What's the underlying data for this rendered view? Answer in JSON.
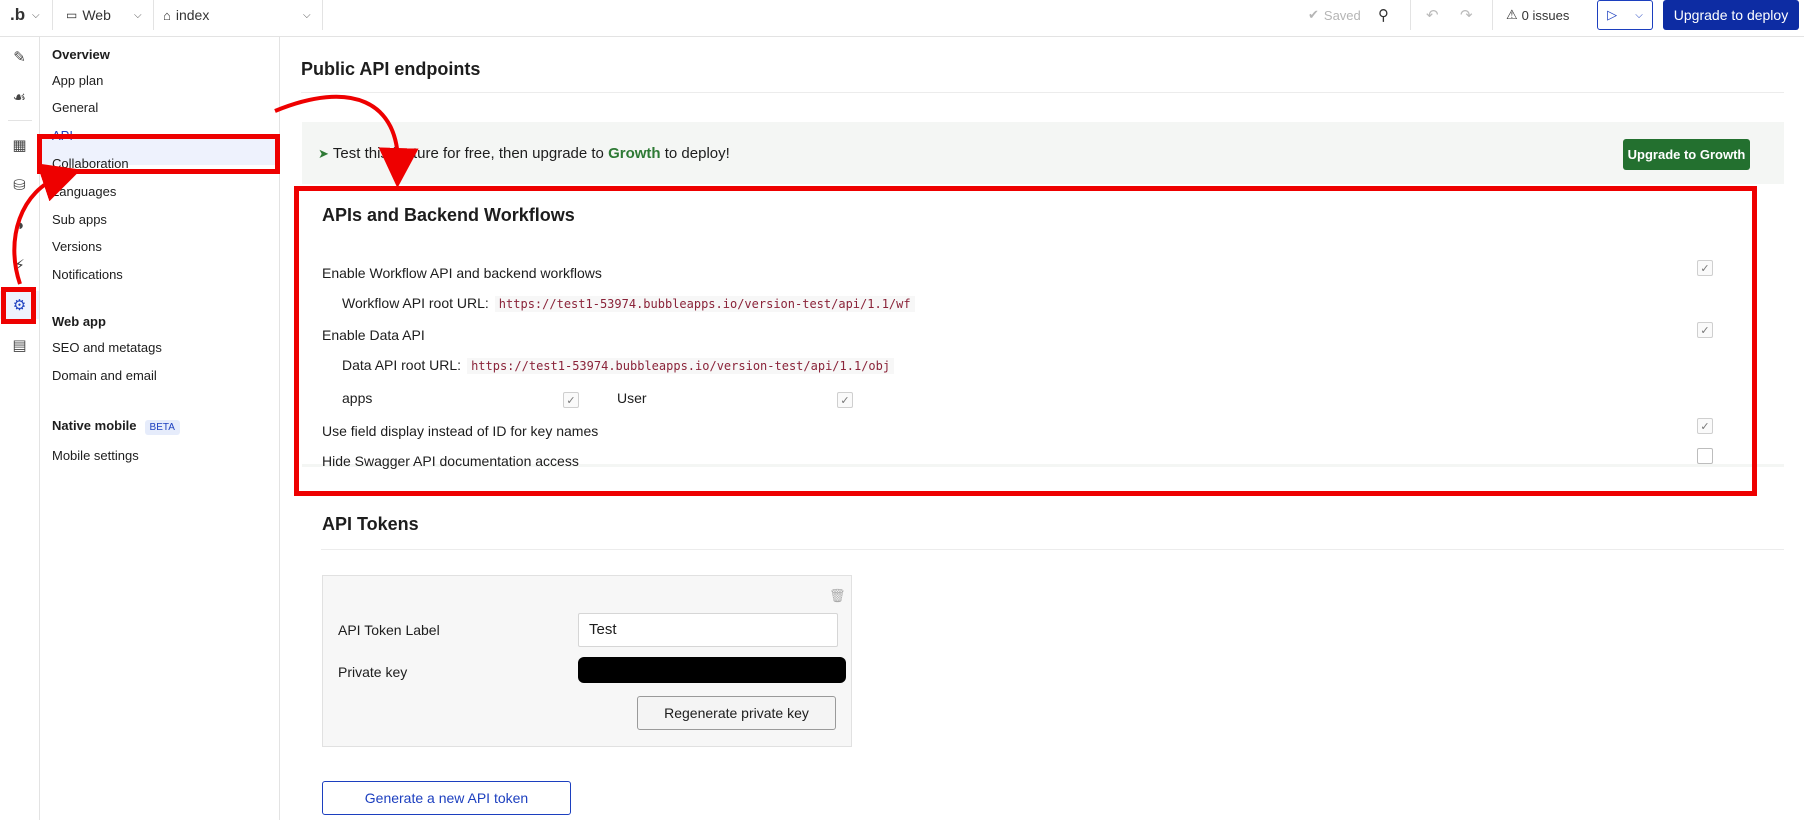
{
  "topbar": {
    "logo": ".b",
    "platform": "Web",
    "page": "index",
    "saved": "Saved",
    "issues": "0 issues",
    "deploy_label": "Upgrade to deploy"
  },
  "rail": {
    "icons": [
      "pencil-icon",
      "sitemap-icon",
      "layout-icon",
      "database-icon",
      "palette-icon",
      "plugin-icon",
      "gear-icon",
      "chart-icon"
    ]
  },
  "nav": {
    "overview": "Overview",
    "items": [
      "App plan",
      "General",
      "API",
      "Collaboration",
      "Languages",
      "Sub apps",
      "Versions",
      "Notifications"
    ],
    "web_app": "Web app",
    "web_items": [
      "SEO and metatags",
      "Domain and email"
    ],
    "native_mobile": "Native mobile",
    "beta": "BETA",
    "mobile_items": [
      "Mobile settings"
    ]
  },
  "main": {
    "title": "Public API endpoints",
    "upgrade_text_before": "Test this feature for free, then upgrade to",
    "upgrade_growth": "Growth",
    "upgrade_text_after": "to deploy!",
    "upgrade_button": "Upgrade to Growth"
  },
  "api": {
    "title": "APIs and Backend Workflows",
    "enable_workflow": "Enable Workflow API and backend workflows",
    "workflow_root_label": "Workflow API root URL:",
    "workflow_root_url": "https://test1-53974.bubbleapps.io/version-test/api/1.1/wf",
    "enable_data": "Enable Data API",
    "data_root_label": "Data API root URL:",
    "data_root_url": "https://test1-53974.bubbleapps.io/version-test/api/1.1/obj",
    "types": [
      "apps",
      "User"
    ],
    "field_display": "Use field display instead of ID for key names",
    "hide_swagger": "Hide Swagger API documentation access"
  },
  "tokens": {
    "title": "API Tokens",
    "label_label": "API Token Label",
    "label_value": "Test",
    "private_key_label": "Private key",
    "regen_button": "Regenerate private key",
    "generate_button": "Generate a new API token"
  },
  "colors": {
    "accent": "#1c3fbf",
    "growth": "#23702f",
    "highlight": "#ee0000"
  }
}
